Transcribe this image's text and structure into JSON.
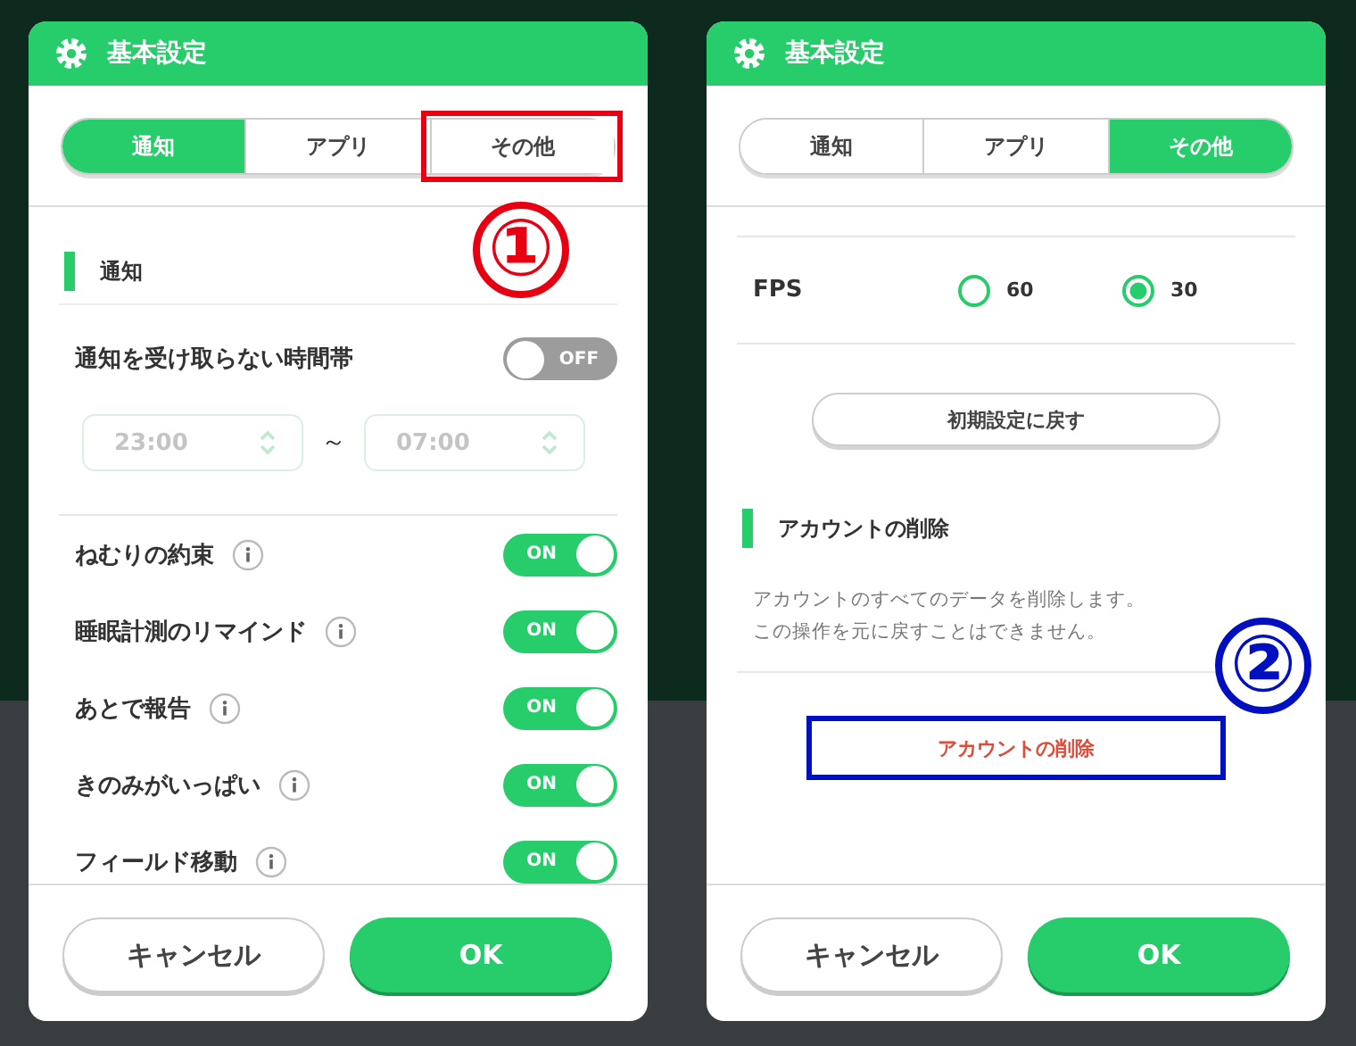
{
  "panels": [
    {
      "title": "基本設定",
      "tabs": [
        {
          "label": "通知",
          "selected": true,
          "marked": false
        },
        {
          "label": "アプリ",
          "selected": false,
          "marked": false
        },
        {
          "label": "その他",
          "selected": false,
          "marked": true
        }
      ],
      "annotation": {
        "marker": "①",
        "color": "#e60012"
      },
      "content": {
        "kind": "notifications",
        "section": "通知",
        "quiet_hours": {
          "label": "通知を受け取らない時間帯",
          "on": false,
          "state_label": "OFF",
          "start": "23:00",
          "separator": "～",
          "end": "07:00"
        },
        "toggles": [
          {
            "label": "ねむりの約束",
            "on": true,
            "state_label": "ON"
          },
          {
            "label": "睡眠計測のリマインド",
            "on": true,
            "state_label": "ON"
          },
          {
            "label": "あとで報告",
            "on": true,
            "state_label": "ON"
          },
          {
            "label": "きのみがいっぱい",
            "on": true,
            "state_label": "ON"
          },
          {
            "label": "フィールド移動",
            "on": true,
            "state_label": "ON"
          }
        ]
      },
      "buttons": [
        {
          "label": "キャンセル",
          "kind": "secondary"
        },
        {
          "label": "OK",
          "kind": "primary"
        }
      ]
    },
    {
      "title": "基本設定",
      "tabs": [
        {
          "label": "通知",
          "selected": false,
          "marked": false
        },
        {
          "label": "アプリ",
          "selected": false,
          "marked": false
        },
        {
          "label": "その他",
          "selected": true,
          "marked": false
        }
      ],
      "annotation": {
        "marker": "②",
        "color": "#0010c0"
      },
      "content": {
        "kind": "other",
        "fps": {
          "label": "FPS",
          "options": [
            {
              "label": "60",
              "selected": false
            },
            {
              "label": "30",
              "selected": true
            }
          ]
        },
        "reset_button": "初期設定に戻す",
        "section": "アカウントの削除",
        "description": [
          "アカウントのすべてのデータを削除します。",
          "この操作を元に戻すことはできません。"
        ],
        "delete_button": {
          "label": "アカウントの削除",
          "marked": true
        }
      },
      "buttons": [
        {
          "label": "キャンセル",
          "kind": "secondary"
        },
        {
          "label": "OK",
          "kind": "primary"
        }
      ]
    }
  ]
}
